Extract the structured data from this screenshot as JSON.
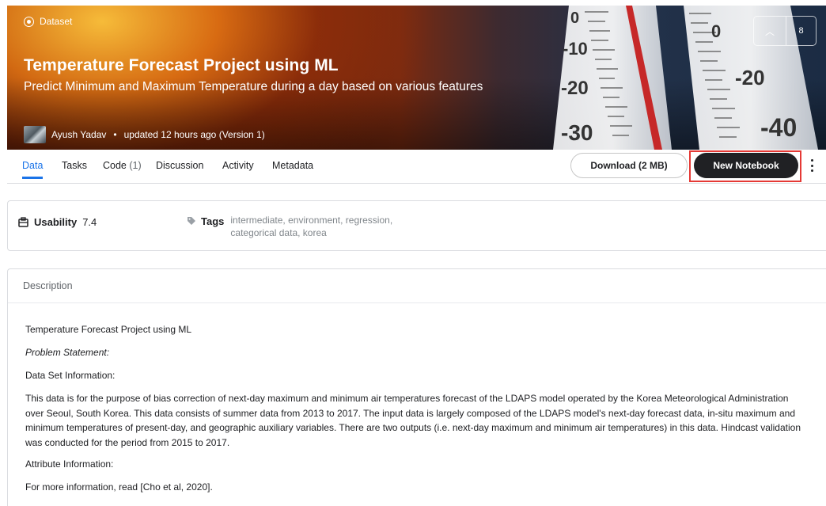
{
  "header": {
    "type_label": "Dataset",
    "title": "Temperature Forecast Project using ML",
    "subtitle": "Predict Minimum and Maximum Temperature during a day based on various features",
    "author": "Ayush Yadav",
    "updated": "updated 12 hours ago (Version 1)",
    "vote_count": "8",
    "vote_icon": "chevron-up-icon",
    "thermometer_labels": [
      "0",
      "-10",
      "-20",
      "-30",
      "0",
      "-20",
      "-40"
    ]
  },
  "tabs": [
    {
      "label": "Data",
      "count": ""
    },
    {
      "label": "Tasks",
      "count": ""
    },
    {
      "label": "Code",
      "count": "(1)"
    },
    {
      "label": "Discussion",
      "count": ""
    },
    {
      "label": "Activity",
      "count": ""
    },
    {
      "label": "Metadata",
      "count": ""
    }
  ],
  "actions": {
    "download_label": "Download (2 MB)",
    "new_notebook_label": "New Notebook",
    "more_icon": "more-vertical-icon"
  },
  "info": {
    "usability_label": "Usability",
    "usability_value": "7.4",
    "tags_label": "Tags",
    "tags_line1": "intermediate, environment, regression,",
    "tags_line2": "categorical data, korea"
  },
  "description": {
    "header": "Description",
    "p1": "Temperature Forecast Project using ML",
    "p2": "Problem Statement:",
    "p3": "Data Set Information:",
    "p4": "This data is for the purpose of bias correction of next-day maximum and minimum air temperatures forecast of the LDAPS model operated by the Korea Meteorological Administration over Seoul, South Korea. This data consists of summer data from 2013 to 2017. The input data is largely composed of the LDAPS model's next-day forecast data, in-situ maximum and minimum temperatures of present-day, and geographic auxiliary variables. There are two outputs (i.e. next-day maximum and minimum air temperatures) in this data. Hindcast validation was conducted for the period from 2015 to 2017.",
    "p5": "Attribute Information:",
    "p6": "For more information, read [Cho et al, 2020]."
  },
  "colors": {
    "accent": "#1a73e8",
    "highlight": "#e53935",
    "primary_button": "#202124"
  }
}
